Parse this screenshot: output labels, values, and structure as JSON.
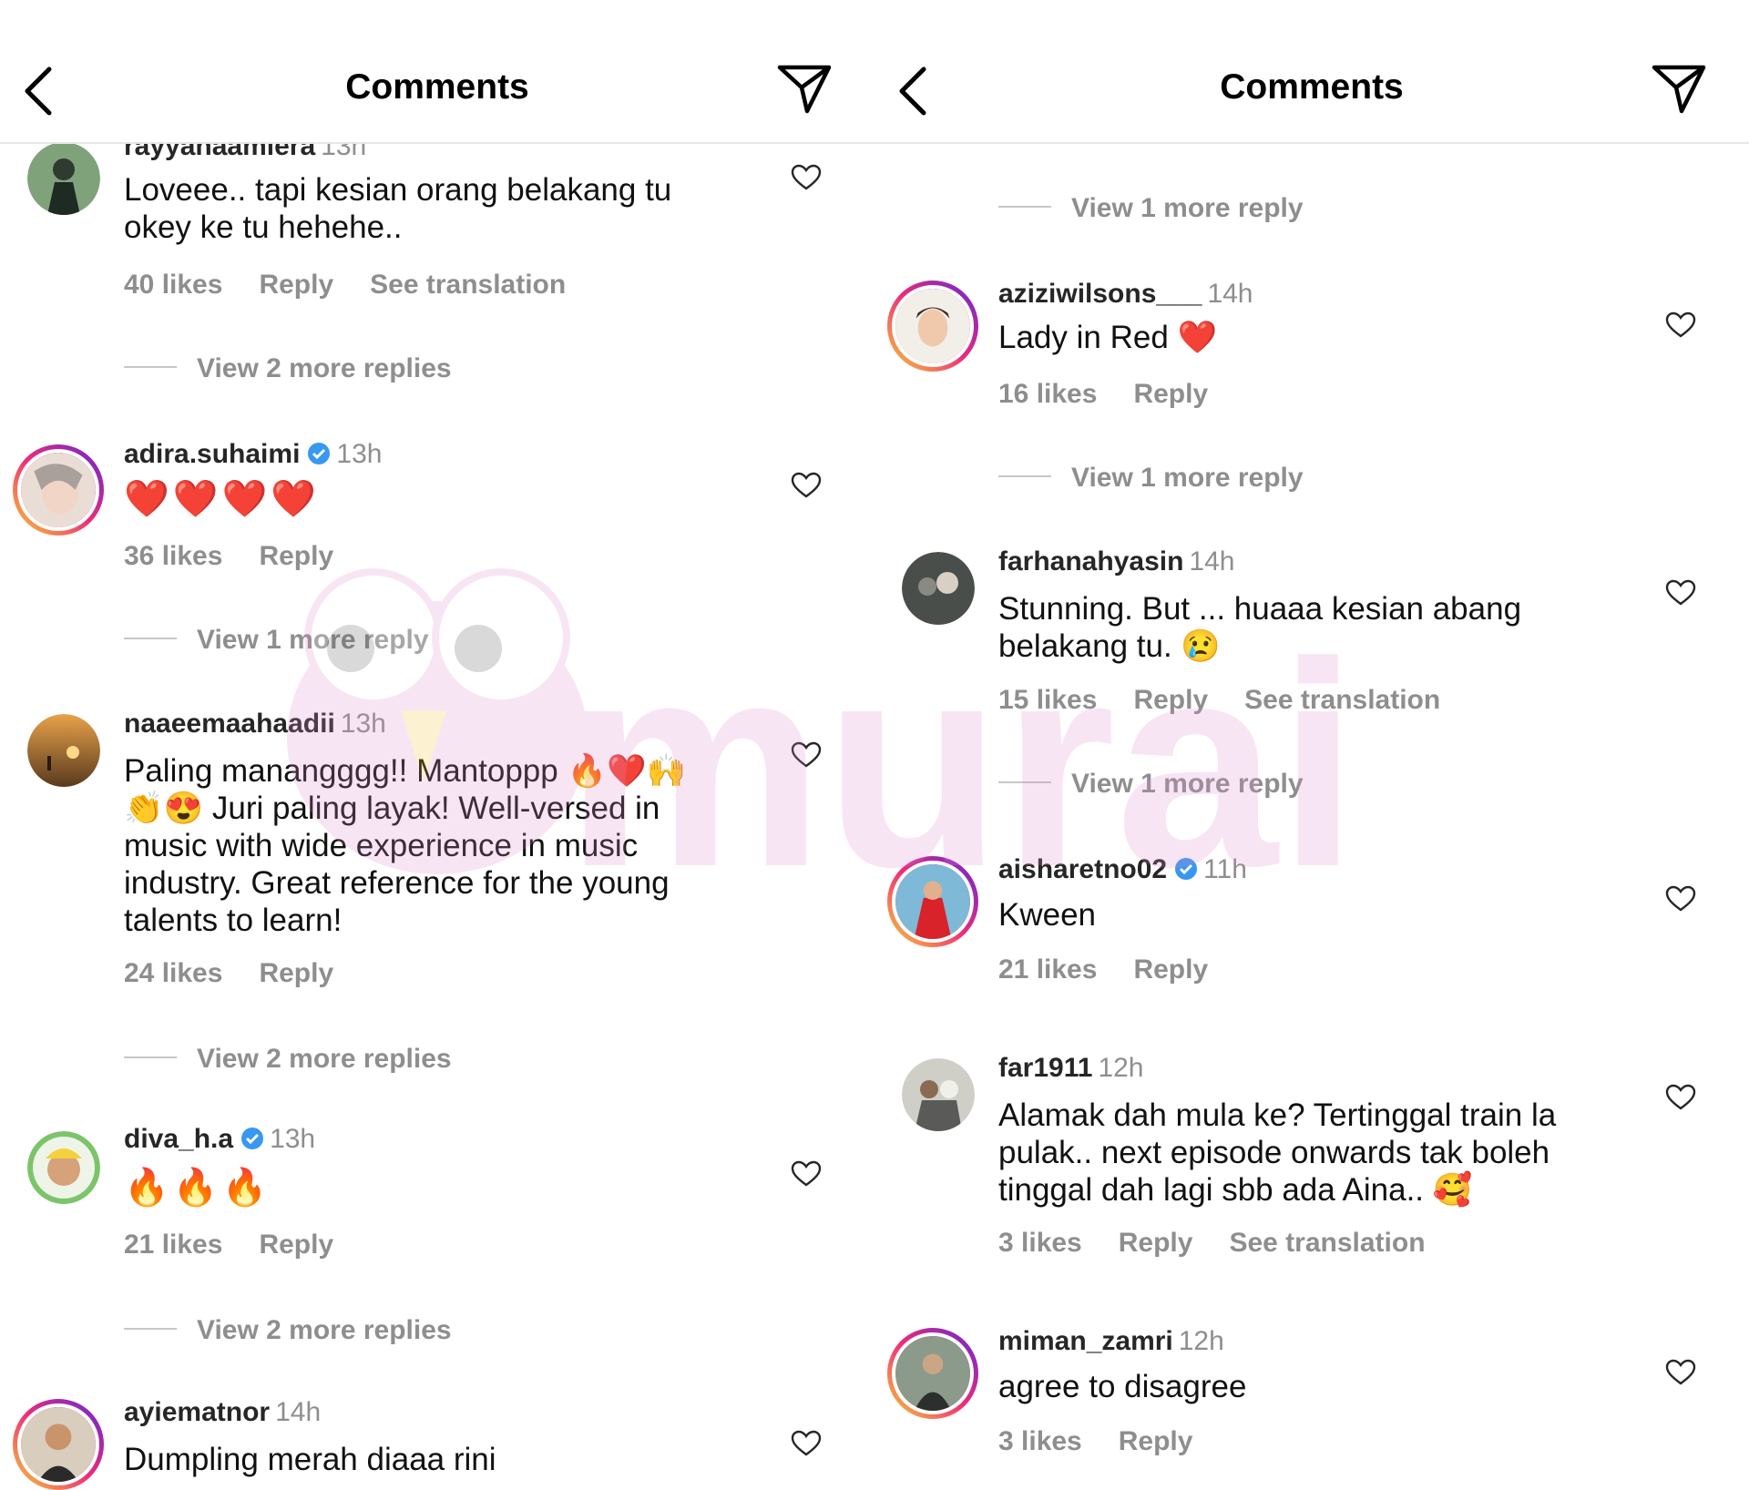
{
  "left_panel": {
    "title": "Comments",
    "comments": [
      {
        "username": "rayyanaamiera",
        "time": "13h",
        "text": "Loveee.. tapi kesian orang belakang tu okey ke tu hehehe..",
        "likes": "40 likes",
        "reply": "Reply",
        "translate": "See translation",
        "view_more": "View 2 more replies"
      },
      {
        "username": "adira.suhaimi",
        "time": "13h",
        "text": "❤️❤️❤️❤️",
        "likes": "36 likes",
        "reply": "Reply",
        "view_more": "View 1 more reply"
      },
      {
        "username": "naaeemaahaadii",
        "time": "13h",
        "text": "Paling manangggg!! Mantoppp 🔥❤️🙌👏😍 Juri paling layak! Well-versed in music with wide experience in music industry. Great reference for the young talents to learn!",
        "likes": "24 likes",
        "reply": "Reply",
        "view_more": "View 2 more replies"
      },
      {
        "username": "diva_h.a",
        "time": "13h",
        "text": "🔥🔥🔥",
        "likes": "21 likes",
        "reply": "Reply",
        "view_more": "View 2 more replies"
      },
      {
        "username": "ayiematnor",
        "time": "14h",
        "text": "Dumpling merah diaaa rini"
      }
    ]
  },
  "right_panel": {
    "title": "Comments",
    "top_view_more": "View 1 more reply",
    "comments": [
      {
        "username": "aziziwilsons___",
        "time": "14h",
        "text": "Lady in Red ❤️",
        "likes": "16 likes",
        "reply": "Reply",
        "view_more": "View 1 more reply"
      },
      {
        "username": "farhanahyasin",
        "time": "14h",
        "text": "Stunning. But ... huaaa kesian abang belakang tu. 😢",
        "likes": "15 likes",
        "reply": "Reply",
        "translate": "See translation",
        "view_more": "View 1 more reply"
      },
      {
        "username": "aisharetno02",
        "time": "11h",
        "text": "Kween",
        "likes": "21 likes",
        "reply": "Reply"
      },
      {
        "username": "far1911",
        "time": "12h",
        "text": "Alamak dah mula ke? Tertinggal train la pulak.. next episode onwards tak boleh tinggal dah lagi sbb ada Aina.. 🥰",
        "likes": "3 likes",
        "reply": "Reply",
        "translate": "See translation"
      },
      {
        "username": "miman_zamri",
        "time": "12h",
        "text": "agree to disagree",
        "likes": "3 likes",
        "reply": "Reply"
      }
    ]
  },
  "icons": {
    "back": "chevron-left-icon",
    "send": "paper-plane-icon",
    "like": "heart-outline-icon",
    "verified": "verified-badge-icon"
  },
  "colors": {
    "muted": "#8e8e8e",
    "verified": "#3897f0",
    "watermark": "#e8a6d9"
  },
  "watermark_text": "murai"
}
